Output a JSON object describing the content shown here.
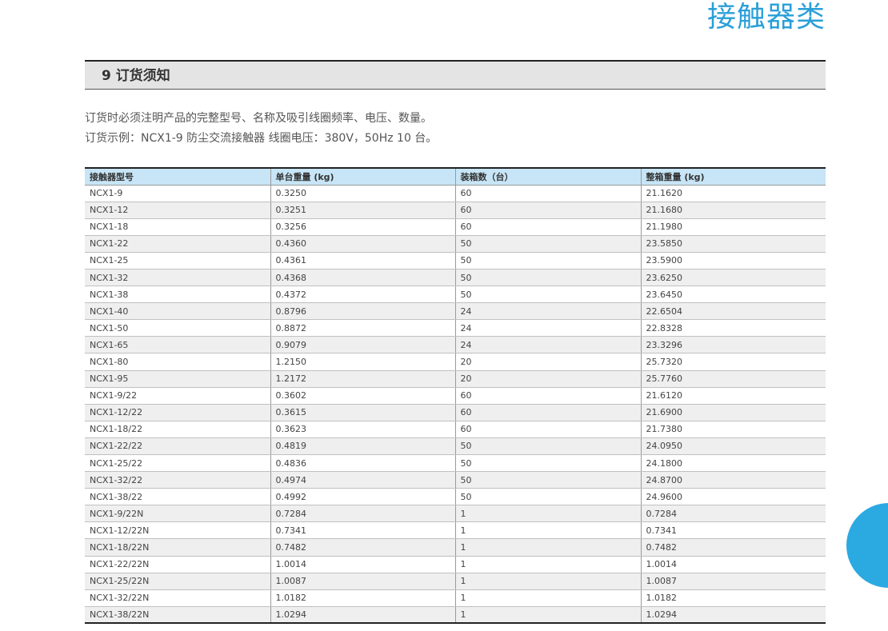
{
  "category_title": "接触器类",
  "section": {
    "title": "9 订货须知"
  },
  "notes": [
    "订货时必须注明产品的完整型号、名称及吸引线圈频率、电压、数量。",
    "订货示例：NCX1-9 防尘交流接触器  线圈电压：380V，50Hz 10 台。"
  ],
  "table": {
    "headers": [
      "接触器型号",
      "单台重量 (kg)",
      "装箱数（台）",
      "整箱重量 (kg)"
    ],
    "rows": [
      [
        "NCX1-9",
        "0.3250",
        "60",
        "21.1620"
      ],
      [
        "NCX1-12",
        "0.3251",
        "60",
        "21.1680"
      ],
      [
        "NCX1-18",
        "0.3256",
        "60",
        "21.1980"
      ],
      [
        "NCX1-22",
        "0.4360",
        "50",
        "23.5850"
      ],
      [
        "NCX1-25",
        "0.4361",
        "50",
        "23.5900"
      ],
      [
        "NCX1-32",
        "0.4368",
        "50",
        "23.6250"
      ],
      [
        "NCX1-38",
        "0.4372",
        "50",
        "23.6450"
      ],
      [
        "NCX1-40",
        "0.8796",
        "24",
        "22.6504"
      ],
      [
        "NCX1-50",
        "0.8872",
        "24",
        "22.8328"
      ],
      [
        "NCX1-65",
        "0.9079",
        "24",
        "23.3296"
      ],
      [
        "NCX1-80",
        "1.2150",
        "20",
        "25.7320"
      ],
      [
        "NCX1-95",
        "1.2172",
        "20",
        "25.7760"
      ],
      [
        "NCX1-9/22",
        "0.3602",
        "60",
        "21.6120"
      ],
      [
        "NCX1-12/22",
        "0.3615",
        "60",
        "21.6900"
      ],
      [
        "NCX1-18/22",
        "0.3623",
        "60",
        "21.7380"
      ],
      [
        "NCX1-22/22",
        "0.4819",
        "50",
        "24.0950"
      ],
      [
        "NCX1-25/22",
        "0.4836",
        "50",
        "24.1800"
      ],
      [
        "NCX1-32/22",
        "0.4974",
        "50",
        "24.8700"
      ],
      [
        "NCX1-38/22",
        "0.4992",
        "50",
        "24.9600"
      ],
      [
        "NCX1-9/22N",
        "0.7284",
        "1",
        "0.7284"
      ],
      [
        "NCX1-12/22N",
        "0.7341",
        "1",
        "0.7341"
      ],
      [
        "NCX1-18/22N",
        "0.7482",
        "1",
        "0.7482"
      ],
      [
        "NCX1-22/22N",
        "1.0014",
        "1",
        "1.0014"
      ],
      [
        "NCX1-25/22N",
        "1.0087",
        "1",
        "1.0087"
      ],
      [
        "NCX1-32/22N",
        "1.0182",
        "1",
        "1.0182"
      ],
      [
        "NCX1-38/22N",
        "1.0294",
        "1",
        "1.0294"
      ]
    ]
  },
  "colors": {
    "accent_blue": "#2ba9e1",
    "title_blue": "#2a9fd8",
    "table_header_bg": "#c7e5f6",
    "section_header_bg": "#e4e4e4"
  }
}
